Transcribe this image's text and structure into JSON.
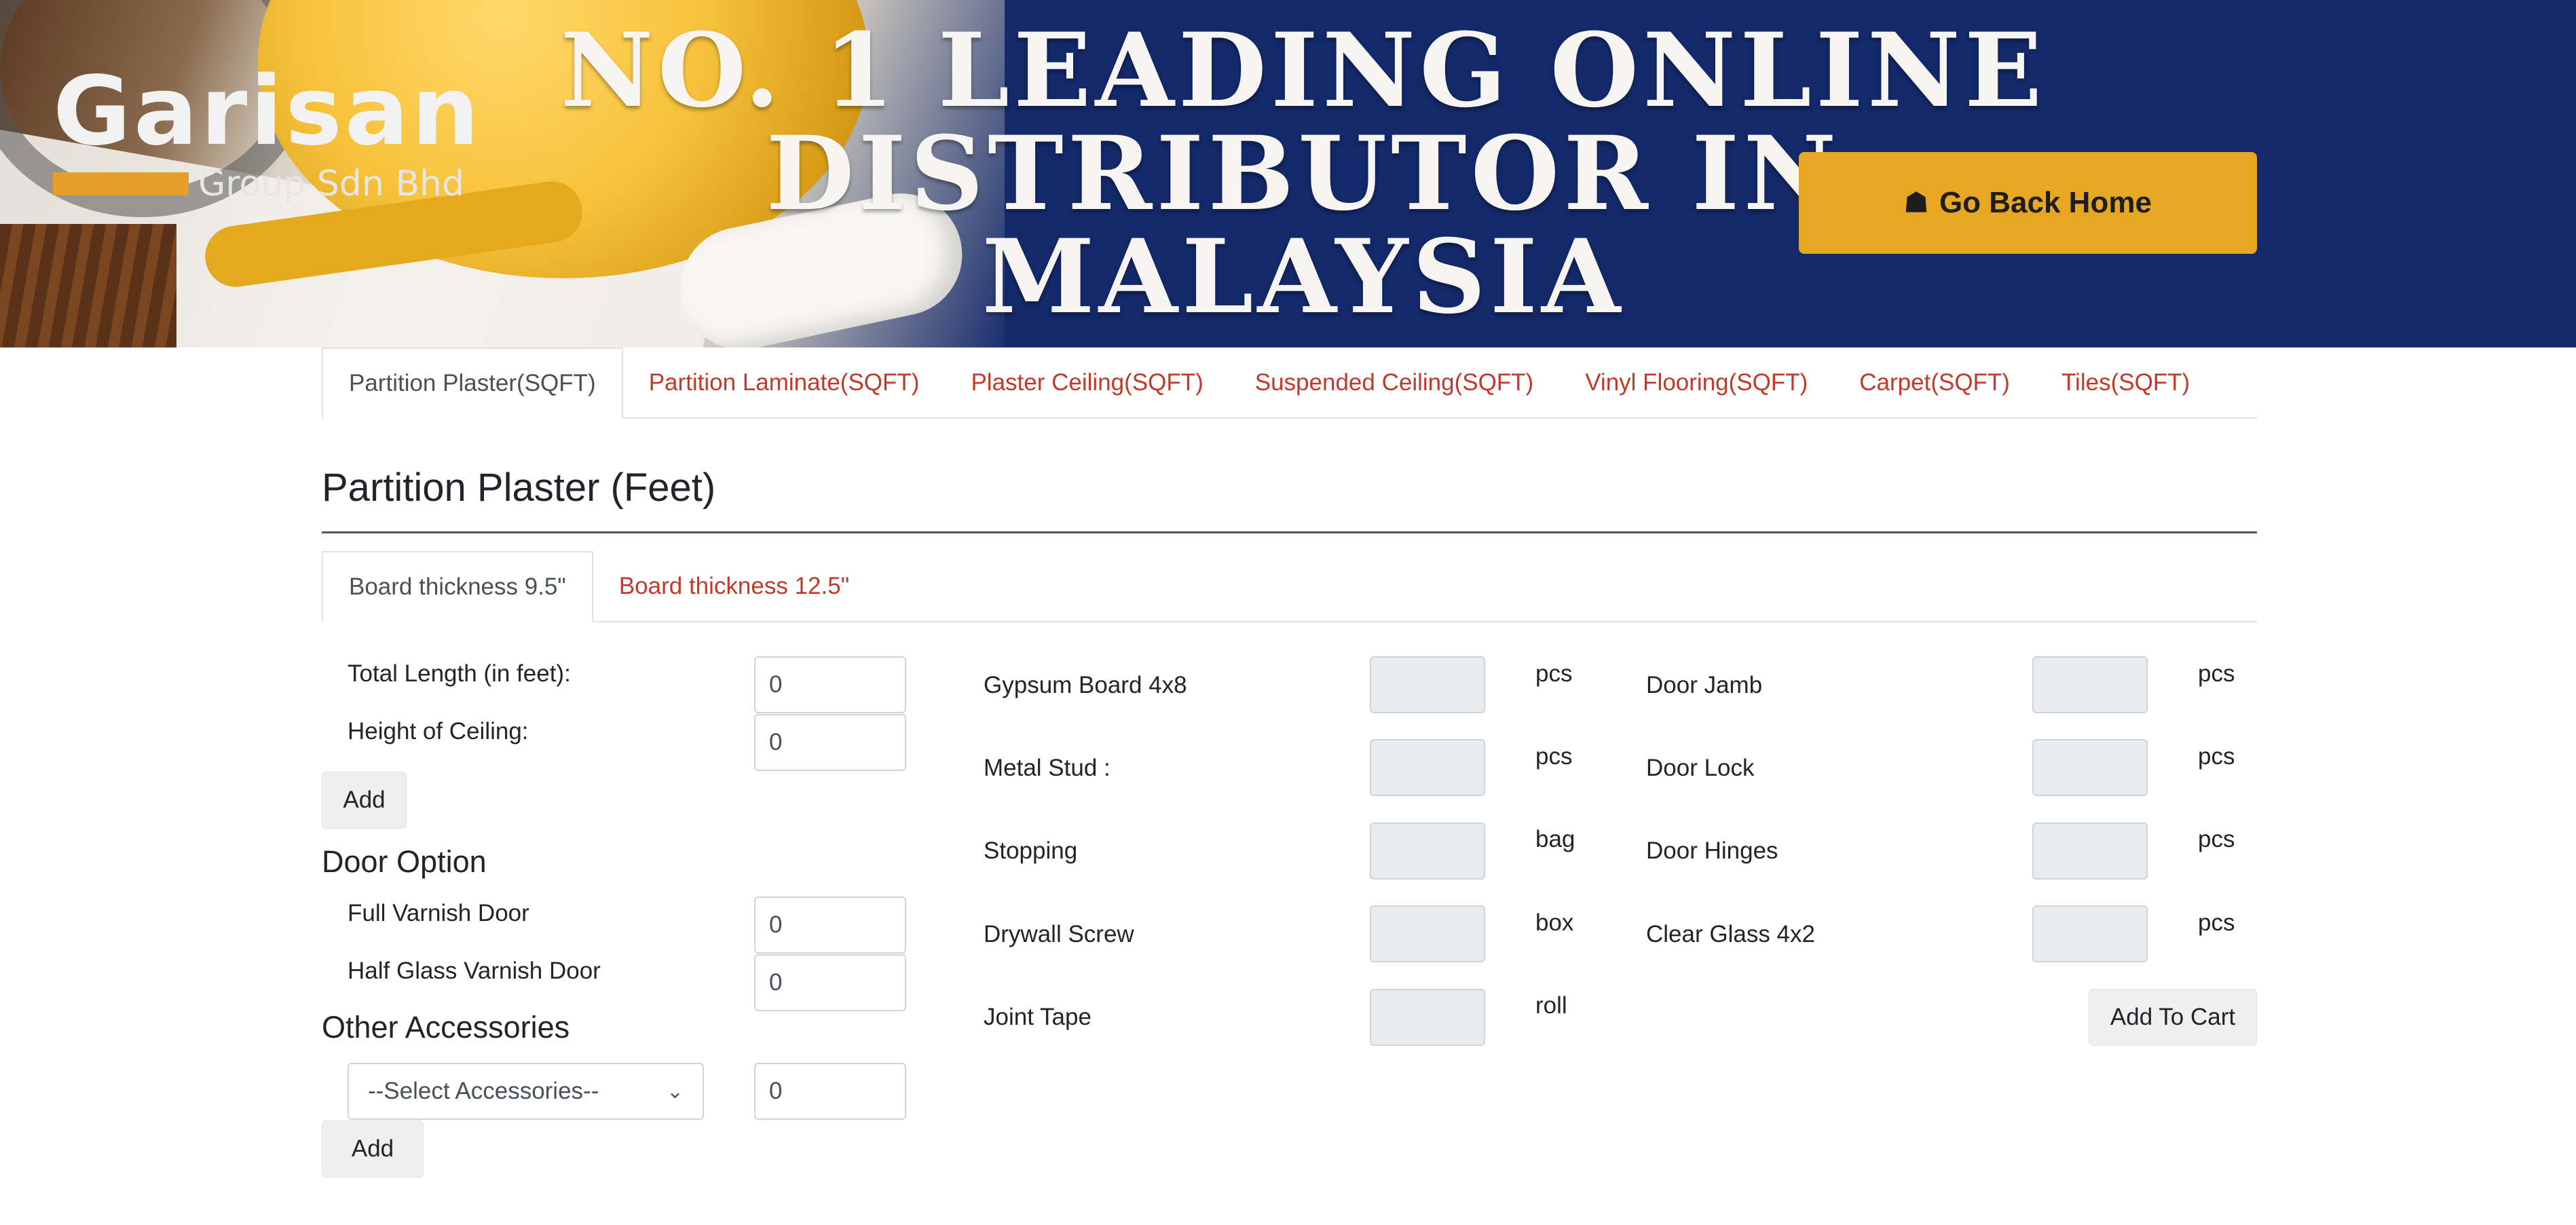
{
  "banner": {
    "logo_name": "Garisan",
    "logo_sub": "Group Sdn Bhd",
    "headline_lines": [
      "NO. 1 LEADING ONLINE",
      "DISTRIBUTOR IN",
      "MALAYSIA"
    ],
    "go_home_label": "Go Back Home",
    "go_home_icon": "home-icon"
  },
  "tabs": [
    {
      "label": "Partition Plaster(SQFT)",
      "active": true
    },
    {
      "label": "Partition Laminate(SQFT)",
      "active": false
    },
    {
      "label": "Plaster Ceiling(SQFT)",
      "active": false
    },
    {
      "label": "Suspended Ceiling(SQFT)",
      "active": false
    },
    {
      "label": "Vinyl Flooring(SQFT)",
      "active": false
    },
    {
      "label": "Carpet(SQFT)",
      "active": false
    },
    {
      "label": "Tiles(SQFT)",
      "active": false
    }
  ],
  "section_title": "Partition Plaster (Feet)",
  "subtabs": [
    {
      "label": "Board thickness 9.5\"",
      "active": true
    },
    {
      "label": "Board thickness 12.5\"",
      "active": false
    }
  ],
  "dimensions": {
    "total_length_label": "Total Length (in feet):",
    "total_length_value": "0",
    "height_label": "Height of Ceiling:",
    "height_value": "0",
    "add_label": "Add"
  },
  "door_option": {
    "heading": "Door Option",
    "full_varnish_label": "Full Varnish Door",
    "full_varnish_value": "0",
    "half_glass_label": "Half Glass Varnish Door",
    "half_glass_value": "0"
  },
  "other_accessories": {
    "heading": "Other Accessories",
    "select_value": "--Select Accessories--",
    "qty_value": "0",
    "add_label": "Add"
  },
  "materials_mid": [
    {
      "name": "Gypsum Board 4x8",
      "unit": "pcs"
    },
    {
      "name": "Metal Stud :",
      "unit": "pcs"
    },
    {
      "name": "Stopping",
      "unit": "bag"
    },
    {
      "name": "Drywall Screw",
      "unit": "box"
    },
    {
      "name": "Joint Tape",
      "unit": "roll"
    }
  ],
  "materials_right": [
    {
      "name": "Door Jamb",
      "unit": "pcs"
    },
    {
      "name": "Door Lock",
      "unit": "pcs"
    },
    {
      "name": "Door Hinges",
      "unit": "pcs"
    },
    {
      "name": "Clear Glass 4x2",
      "unit": "pcs"
    }
  ],
  "add_to_cart_label": "Add To Cart",
  "colors": {
    "banner_navy": "#14296a",
    "home_button": "#e8a722",
    "tab_link": "#c0392b",
    "logo_accent": "#e79d2a"
  }
}
